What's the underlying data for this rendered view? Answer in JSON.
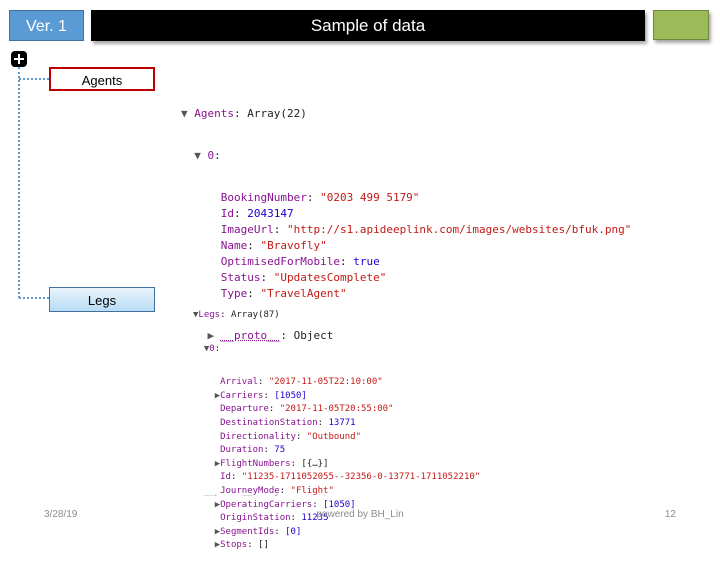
{
  "header": {
    "version": "Ver. 1",
    "title": "Sample of data",
    "colors": {
      "version_bg": "#5b9bd5",
      "title_bg": "#000000",
      "accent_green": "#9bbb59"
    }
  },
  "tree": {
    "expand_icon": "plus-icon",
    "agents_label": "Agents",
    "legs_label": "Legs"
  },
  "agents_console": {
    "header_key": "Agents",
    "header_value": "Array(22)",
    "index": "0",
    "fields": [
      {
        "key": "BookingNumber",
        "value": "\"0203 499 5179\"",
        "kind": "str"
      },
      {
        "key": "Id",
        "value": "2043147",
        "kind": "num"
      },
      {
        "key": "ImageUrl",
        "value": "\"http://s1.apideeplink.com/images/websites/bfuk.png\"",
        "kind": "str"
      },
      {
        "key": "Name",
        "value": "\"Bravofly\"",
        "kind": "str"
      },
      {
        "key": "OptimisedForMobile",
        "value": "true",
        "kind": "kw"
      },
      {
        "key": "Status",
        "value": "\"UpdatesComplete\"",
        "kind": "str"
      },
      {
        "key": "Type",
        "value": "\"TravelAgent\"",
        "kind": "str"
      }
    ],
    "proto_key": "__proto__",
    "proto_value": "Object"
  },
  "legs_console": {
    "header_key": "Legs",
    "header_value": "Array(87)",
    "index": "0",
    "fields": [
      {
        "key": "Arrival",
        "value": "\"2017-11-05T22:10:00\"",
        "kind": "str",
        "expandable": false
      },
      {
        "key": "Carriers",
        "value": "[1050]",
        "kind": "num",
        "expandable": true
      },
      {
        "key": "Departure",
        "value": "\"2017-11-05T20:55:00\"",
        "kind": "str",
        "expandable": false
      },
      {
        "key": "DestinationStation",
        "value": "13771",
        "kind": "num",
        "expandable": false
      },
      {
        "key": "Directionality",
        "value": "\"Outbound\"",
        "kind": "str",
        "expandable": false
      },
      {
        "key": "Duration",
        "value": "75",
        "kind": "num",
        "expandable": false
      },
      {
        "key": "FlightNumbers",
        "value": "[{…}]",
        "kind": "plain",
        "expandable": true
      },
      {
        "key": "Id",
        "value": "\"11235-1711052055--32356-0-13771-1711052210\"",
        "kind": "str",
        "expandable": false
      },
      {
        "key": "JourneyMode",
        "value": "\"Flight\"",
        "kind": "str",
        "expandable": false
      },
      {
        "key": "OperatingCarriers",
        "value": "[1050]",
        "kind": "num",
        "expandable": true
      },
      {
        "key": "OriginStation",
        "value": "11235",
        "kind": "num",
        "expandable": false
      },
      {
        "key": "SegmentIds",
        "value": "[0]",
        "kind": "num",
        "expandable": true
      },
      {
        "key": "Stops",
        "value": "[]",
        "kind": "plain",
        "expandable": true
      }
    ]
  },
  "footer": {
    "date": "3/28/19",
    "credit": "powered by BH_Lin",
    "page": "12"
  }
}
